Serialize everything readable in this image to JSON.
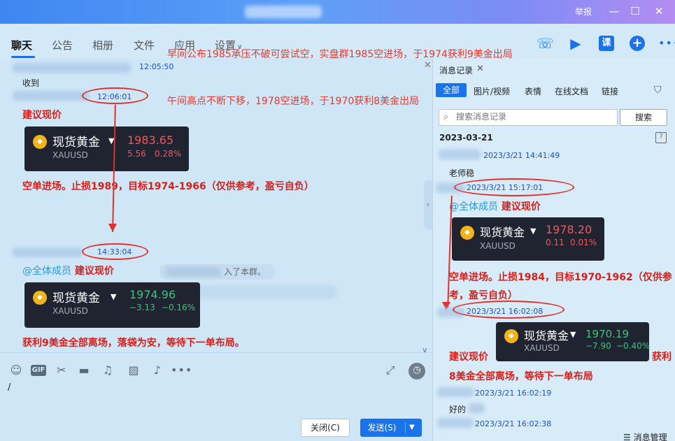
{
  "window": {
    "report_label": "举报",
    "min_icon": "minimize-icon",
    "max_icon": "maximize-icon",
    "close_icon": "close-icon"
  },
  "nav": {
    "tabs": [
      "聊天",
      "公告",
      "相册",
      "文件",
      "应用",
      "设置"
    ],
    "active_tab": "聊天",
    "icons": [
      "phone-icon",
      "video-icon",
      "course-icon",
      "plus-icon",
      "more-icon"
    ],
    "course_label": "课"
  },
  "overlay_note_top": "早间公布1985承压不破可尝试空，实盘群1985空进场，于1974获利9美金出局",
  "chat": {
    "note_mid": "午间高点不断下移，1978空进场，于1970获利8美金出局",
    "messages": [
      {
        "time": "12:05:50",
        "text": "收到"
      },
      {
        "time": "12:06:01",
        "text": "建议现价",
        "card": {
          "name": "现货黄金",
          "code": "XAUUSD",
          "price": "1983.65",
          "change": "5.56",
          "pct": "0.28%",
          "direction": "up"
        },
        "after": "空单进场。止损1989，目标1974-1966（仅供参考，盈亏自负）"
      },
      {
        "system": "入了本群。"
      },
      {
        "time": "14:33:04",
        "mention": "@全体成员",
        "text": "建议现价",
        "card": {
          "name": "现货黄金",
          "code": "XAUUSD",
          "price": "1974.96",
          "change": "−3.13",
          "pct": "−0.16%",
          "direction": "down"
        },
        "after": "获利9美金全部离场，落袋为安，等待下一单布局。"
      }
    ]
  },
  "input": {
    "tools": [
      "emoji-icon",
      "gif-icon",
      "scissors-icon",
      "folder-icon",
      "music-icon",
      "image-icon",
      "bell-icon",
      "more-icon"
    ],
    "gif_label": "GIF",
    "value": "/",
    "close_label": "关闭(C)",
    "send_label": "发送(S)"
  },
  "history": {
    "title": "消息记录",
    "tabs": [
      "全部",
      "图片/视频",
      "表情",
      "在线文档",
      "链接"
    ],
    "search_placeholder": "搜索消息记录",
    "search_button": "搜索",
    "date": "2023-03-21",
    "entries": [
      {
        "time": "2023/3/21 14:41:49",
        "text": "老师稳"
      },
      {
        "time": "2023/3/21 15:17:01",
        "mention": "@全体成员",
        "text": "建议现价",
        "card": {
          "name": "现货黄金",
          "code": "XAUUSD",
          "price": "1978.20",
          "change": "0.11",
          "pct": "0.01%",
          "direction": "up"
        },
        "after": "空单进场。止损1984，目标1970-1962（仅供参考，盈亏自负）"
      },
      {
        "time": "2023/3/21 16:02:08",
        "card": {
          "name": "现货黄金",
          "code": "XAUUSD",
          "price": "1970.19",
          "change": "−7.90",
          "pct": "−0.40%",
          "direction": "down"
        },
        "after_a": "建议现价",
        "after_b": "获利",
        "after_c": "8美金全部离场，等待下一单布局"
      },
      {
        "time": "2023/3/21 16:02:19",
        "text": "好的"
      },
      {
        "time": "2023/3/21 16:02:38"
      }
    ],
    "footer": "消息管理"
  },
  "colors": {
    "accent": "#1a73e8",
    "annotation_red": "#e0312a",
    "up": "#f0585a",
    "down": "#3fc07d"
  }
}
